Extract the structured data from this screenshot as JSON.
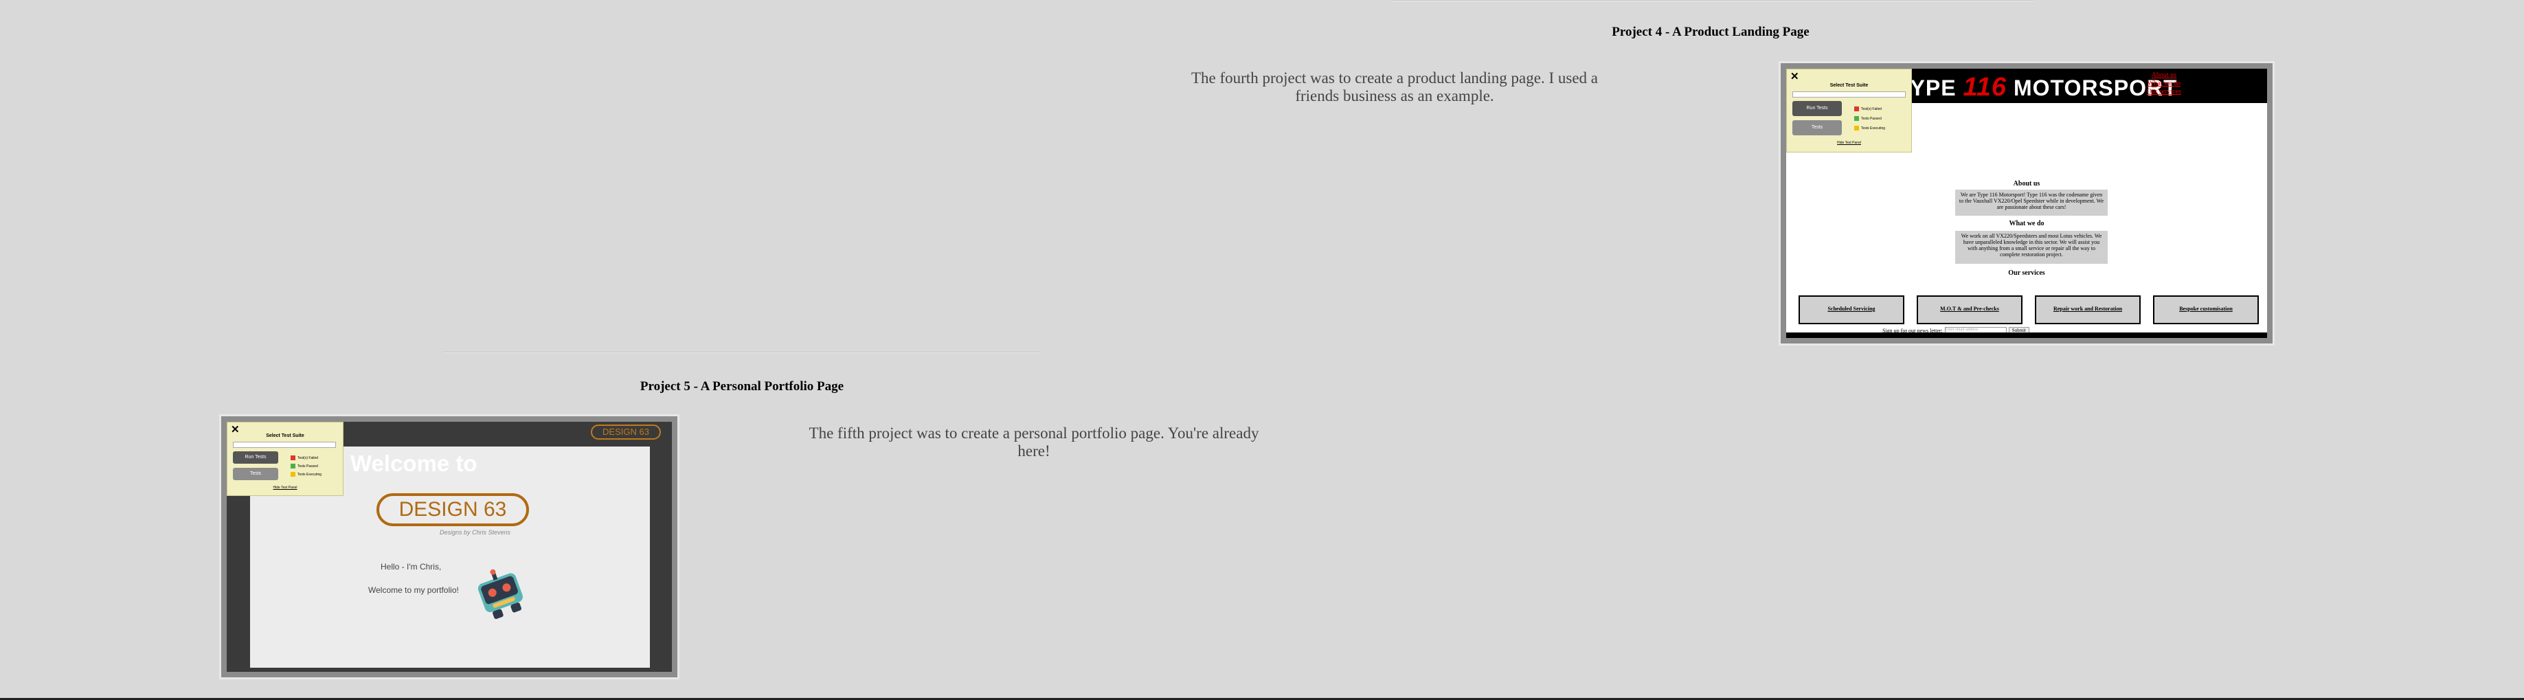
{
  "project4": {
    "heading": "Project 4 - A Product Landing Page",
    "description": "The fourth project was to create a product landing page. I used a friends business as an example.",
    "screenshot": {
      "logo_prefix": "TYPE",
      "logo_number": "116",
      "logo_suffix": "MOTORSPORT",
      "nav": [
        "About us",
        "What we do",
        "Our services"
      ],
      "about_heading": "About us",
      "about_text": "We are Type 116 Motorsport! Type 116 was the codename given to the Vauxhall VX220/Opel Speedster while in development. We are passionate about these cars!",
      "what_heading": "What we do",
      "what_text": "We work on all VX220/Speedsters and most Lotus vehicles. We have unparalleled knowledge in this sector. We will assist you with anything from a small service or repair all the way to complete restoration project.",
      "services_heading": "Our services",
      "services": [
        "Scheduled Servicing",
        "M.O.T & and Pre-checks",
        "Repair work and Restoration",
        "Bespoke customisation"
      ],
      "signup_label": "Sign up for our news letter:",
      "signup_placeholder": "Enter email address",
      "signup_button": "Submit"
    }
  },
  "project5": {
    "heading": "Project 5 - A Personal Portfolio Page",
    "description": "The fifth project was to create a personal portfolio page. You're already here!",
    "screenshot": {
      "logo_small": "DESIGN 63",
      "welcome": "Welcome to",
      "logo_big": "DESIGN 63",
      "tagline": "Designs by Chris Stevens",
      "hello": "Hello - I'm Chris,",
      "welcome_portfolio": "Welcome to my portfolio!"
    }
  },
  "test_panel": {
    "title": "Select Test Suite",
    "run_label": "Run Tests",
    "tests_label": "Tests",
    "legend": [
      "Test(s) Failed",
      "Tests Passed",
      "Tests Executing"
    ],
    "hide_label": "Hide Test Panel"
  },
  "colors": {
    "background": "#d9d9d9",
    "failed": "#e0362d",
    "passed": "#4caf50",
    "executing": "#f0c000",
    "accent_orange": "#c07a1a"
  }
}
